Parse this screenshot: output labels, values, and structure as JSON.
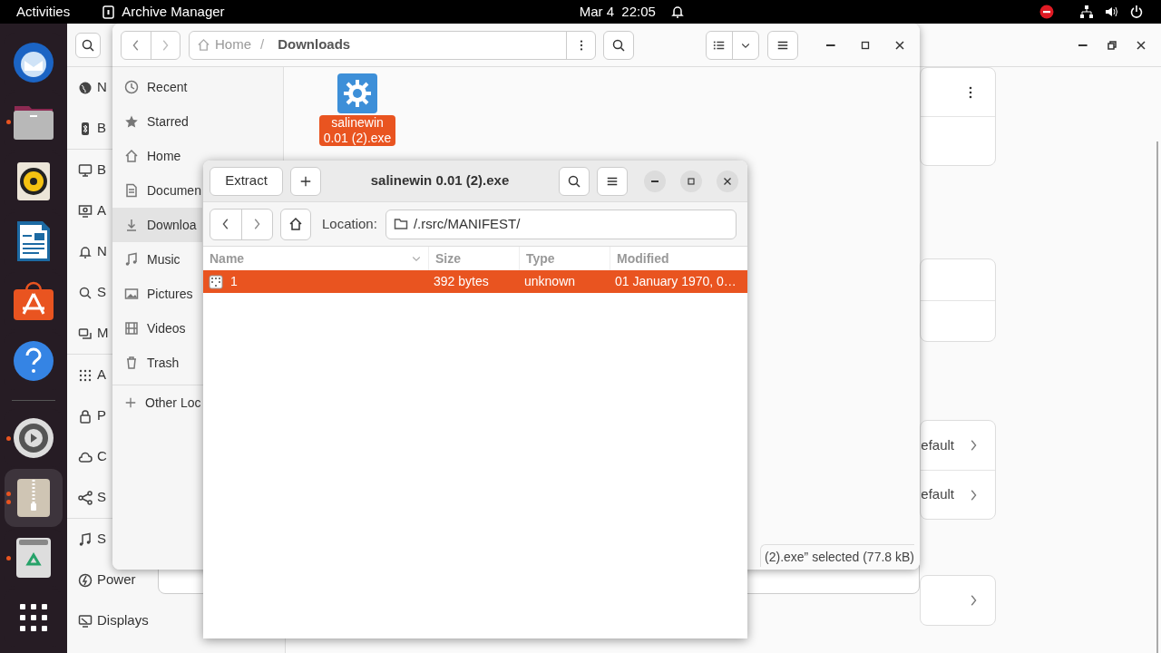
{
  "top_bar": {
    "activities": "Activities",
    "app_name": "Archive Manager",
    "date": "Mar 4",
    "time": "22:05"
  },
  "dock": [
    {
      "kind": "mail",
      "running": false,
      "selected": false,
      "multiple": false
    },
    {
      "kind": "files",
      "running": true,
      "selected": false,
      "multiple": false
    },
    {
      "kind": "speaker",
      "running": false,
      "selected": false,
      "multiple": false
    },
    {
      "kind": "document",
      "running": false,
      "selected": false,
      "multiple": false
    },
    {
      "kind": "store",
      "running": false,
      "selected": false,
      "multiple": false
    },
    {
      "kind": "help",
      "running": false,
      "selected": false,
      "multiple": false
    },
    {
      "kind": "separator"
    },
    {
      "kind": "settings",
      "running": true,
      "selected": false,
      "multiple": false
    },
    {
      "kind": "archive",
      "running": true,
      "selected": true,
      "multiple": true
    },
    {
      "kind": "trash",
      "running": true,
      "selected": false,
      "multiple": false
    },
    {
      "kind": "apps",
      "running": false,
      "selected": false,
      "multiple": false
    }
  ],
  "settings_window": {
    "sidebar_groups": [
      [
        "N",
        "B"
      ],
      [
        "B",
        "A",
        "N",
        "S",
        "M"
      ],
      [
        "A",
        "P",
        "C",
        "S"
      ],
      [
        "S",
        "Power",
        "Displays"
      ]
    ],
    "cards": [
      {
        "rows": [
          {
            "kind": "menu"
          },
          {
            "kind": "blank"
          }
        ]
      },
      {
        "rows": [
          {
            "kind": "blank"
          },
          {
            "kind": "blank"
          }
        ]
      },
      {
        "rows": [
          {
            "kind": "link",
            "text": "efault"
          },
          {
            "kind": "link",
            "text": "efault"
          }
        ]
      },
      {
        "rows": [
          {
            "kind": "link"
          }
        ]
      }
    ]
  },
  "files_window": {
    "path": [
      "Home",
      "Downloads"
    ],
    "path_separator": "/",
    "sidebar": [
      {
        "label": "Recent",
        "selected": false
      },
      {
        "label": "Starred",
        "selected": false
      },
      {
        "label": "Home",
        "selected": false
      },
      {
        "label": "Documen",
        "selected": false
      },
      {
        "label": "Downloa",
        "selected": true
      },
      {
        "label": "Music",
        "selected": false
      },
      {
        "label": "Pictures",
        "selected": false
      },
      {
        "label": "Videos",
        "selected": false
      },
      {
        "label": "Trash",
        "selected": false
      }
    ],
    "other_locations": "Other Loc",
    "files": [
      {
        "name": "salinewin 0.01 (2).exe",
        "selected": true
      }
    ],
    "status": "(2).exe” selected  (77.8 kB)"
  },
  "archive_window": {
    "title": "salinewin 0.01 (2).exe",
    "extract": "Extract",
    "location_label": "Location:",
    "location": "/.rsrc/MANIFEST/",
    "columns": [
      "Name",
      "Size",
      "Type",
      "Modified"
    ],
    "rows": [
      {
        "name": "1",
        "size": "392 bytes",
        "type": "unknown",
        "modified": "01 January 1970, 0…",
        "selected": true
      }
    ]
  }
}
